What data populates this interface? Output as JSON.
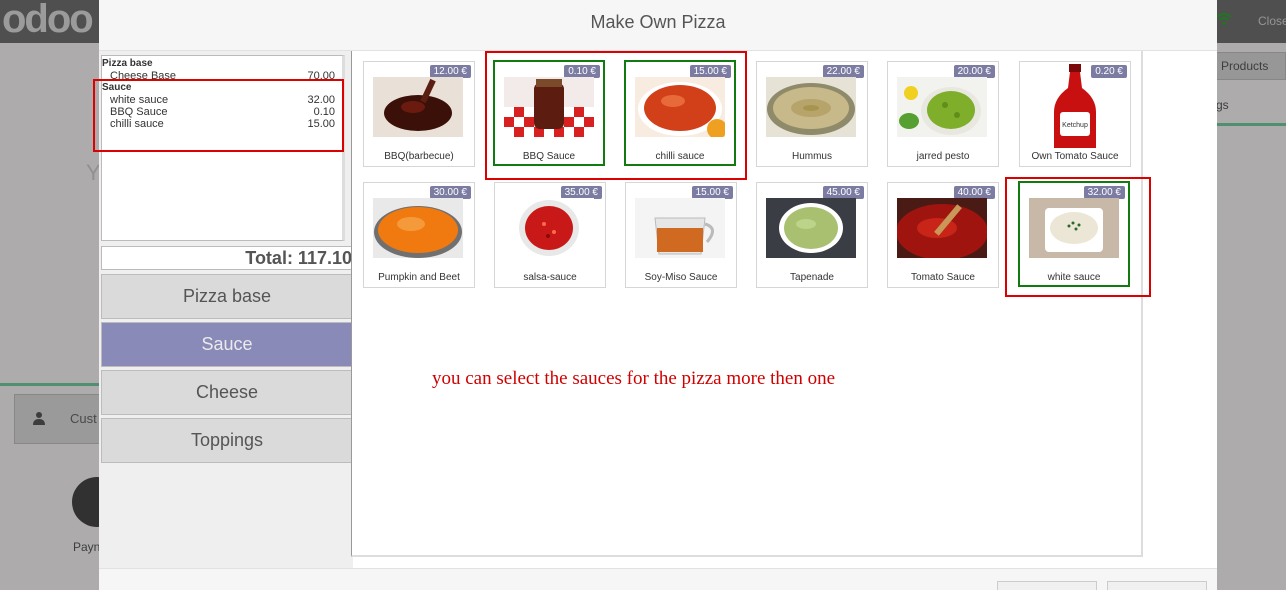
{
  "background": {
    "logo": "odoo",
    "close_label": "Close",
    "right_btn1": "n Products",
    "right_btn2": "gs",
    "customer_label": "Cust",
    "payment_label": "Payn",
    "faded_letter": "Y"
  },
  "modal": {
    "title": "Make Own Pizza"
  },
  "summary": {
    "groups": [
      {
        "title": "Pizza base",
        "lines": [
          {
            "name": "Cheese Base",
            "price": "70.00"
          }
        ]
      },
      {
        "title": "Sauce",
        "lines": [
          {
            "name": "white sauce",
            "price": "32.00"
          },
          {
            "name": "BBQ Sauce",
            "price": "0.10"
          },
          {
            "name": "chilli sauce",
            "price": "15.00"
          }
        ]
      }
    ],
    "total": "Total: 117.10"
  },
  "categories": [
    {
      "label": "Pizza base",
      "active": false
    },
    {
      "label": "Sauce",
      "active": true
    },
    {
      "label": "Cheese",
      "active": false
    },
    {
      "label": "Toppings",
      "active": false
    }
  ],
  "products": [
    {
      "name": "BBQ(barbecue)",
      "price": "12.00 €",
      "selected": false,
      "icon": "bbq-sauce-image"
    },
    {
      "name": "BBQ Sauce",
      "price": "0.10 €",
      "selected": true,
      "icon": "bbq-jar-image"
    },
    {
      "name": "chilli sauce",
      "price": "15.00 €",
      "selected": true,
      "icon": "chilli-bowl-image"
    },
    {
      "name": "Hummus",
      "price": "22.00 €",
      "selected": false,
      "icon": "hummus-image"
    },
    {
      "name": "jarred pesto",
      "price": "20.00 €",
      "selected": false,
      "icon": "pesto-image"
    },
    {
      "name": "Own Tomato Sauce",
      "price": "0.20 €",
      "selected": false,
      "icon": "ketchup-bottle-image"
    },
    {
      "name": "Pumpkin and Beet",
      "price": "30.00 €",
      "selected": false,
      "icon": "pumpkin-sauce-image"
    },
    {
      "name": "salsa-sauce",
      "price": "35.00 €",
      "selected": false,
      "icon": "salsa-image"
    },
    {
      "name": "Soy-Miso Sauce",
      "price": "15.00 €",
      "selected": false,
      "icon": "soy-miso-image"
    },
    {
      "name": "Tapenade",
      "price": "45.00 €",
      "selected": false,
      "icon": "tapenade-image"
    },
    {
      "name": "Tomato Sauce",
      "price": "40.00 €",
      "selected": false,
      "icon": "tomato-sauce-image"
    },
    {
      "name": "white sauce",
      "price": "32.00 €",
      "selected": true,
      "icon": "white-sauce-image"
    }
  ],
  "annotation": {
    "note": "you can select the sauces for the pizza more then one",
    "color": "#d00000"
  },
  "colors": {
    "active_category": "#8a8ab8",
    "price_tag": "#7c7ca3",
    "selected_border": "#117a11",
    "highlight_box": "#dd0000"
  }
}
